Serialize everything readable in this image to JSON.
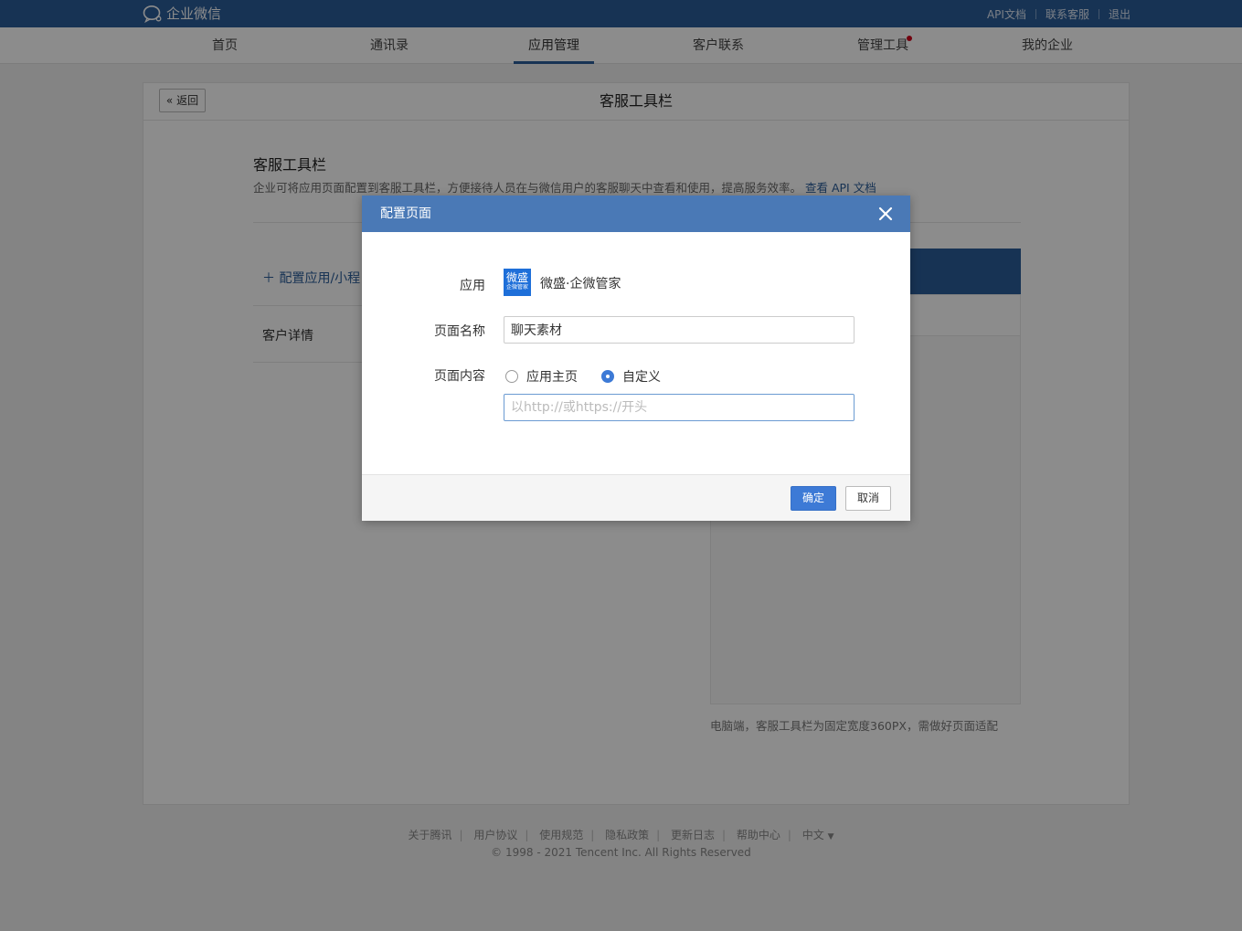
{
  "topbar": {
    "brand": "企业微信",
    "links": [
      "API文档",
      "联系客服",
      "退出"
    ]
  },
  "nav": {
    "items": [
      "首页",
      "通讯录",
      "应用管理",
      "客户联系",
      "管理工具",
      "我的企业"
    ],
    "active": "应用管理"
  },
  "page": {
    "back_label": "返回",
    "title": "客服工具栏",
    "section_title": "客服工具栏",
    "section_desc": "企业可将应用页面配置到客服工具栏，方便接待人员在与微信用户的客服聊天中查看和使用，提高服务效率。",
    "api_link": "查看 API 文档",
    "add_label": "配置应用/小程",
    "customer_details": "客户详情",
    "preview_note": "电脑端，客服工具栏为固定宽度360PX，需做好页面适配"
  },
  "footer": {
    "links": [
      "关于腾讯",
      "用户协议",
      "使用规范",
      "隐私政策",
      "更新日志",
      "帮助中心",
      "中文"
    ],
    "copyright": "© 1998 - 2021 Tencent Inc. All Rights Reserved"
  },
  "modal": {
    "title": "配置页面",
    "app_label": "应用",
    "app_icon_text": "微盛",
    "app_icon_sub": "企微管家",
    "app_name": "微盛·企微管家",
    "page_name_label": "页面名称",
    "page_name_value": "聊天素材",
    "page_content_label": "页面内容",
    "radio_home": "应用主页",
    "radio_custom": "自定义",
    "url_placeholder": "以http://或https://开头",
    "confirm": "确定",
    "cancel": "取消"
  },
  "colors": {
    "brand": "#2b5d9a",
    "modal_header": "#4a79b6",
    "primary_button": "#3d7ad6",
    "notification_dot": "#d0021b"
  }
}
